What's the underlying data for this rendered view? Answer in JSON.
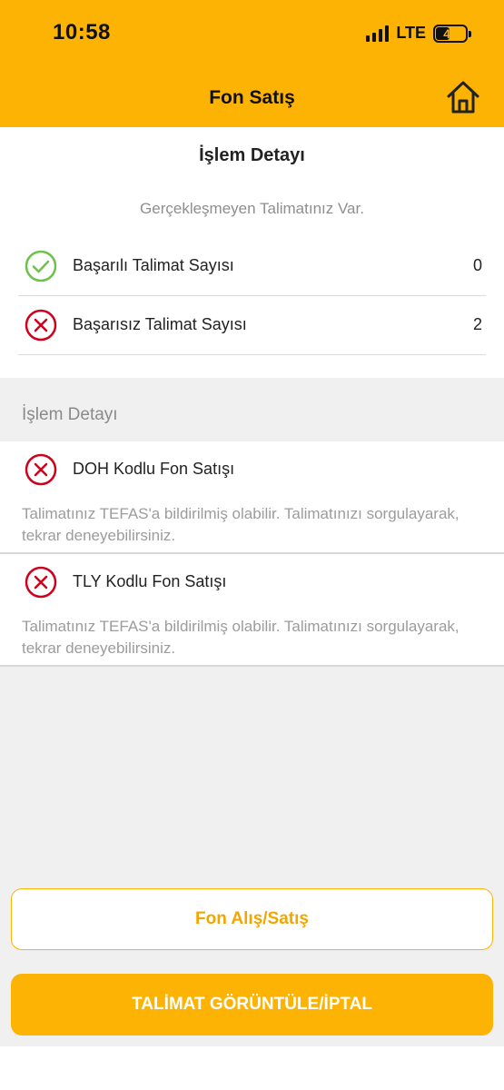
{
  "status_bar": {
    "time": "10:58",
    "network": "LTE",
    "battery": "47",
    "battery_level_pct": 47
  },
  "header": {
    "title": "Fon Satış",
    "home_icon": "home-icon"
  },
  "summary": {
    "title": "İşlem Detayı",
    "notice": "Gerçekleşmeyen Talimatınız Var.",
    "rows": [
      {
        "label": "Başarılı Talimat Sayısı",
        "value": "0",
        "icon": "check-circle-icon"
      },
      {
        "label": "Başarısız Talimat Sayısı",
        "value": "2",
        "icon": "error-circle-icon"
      }
    ]
  },
  "details": {
    "header": "İşlem Detayı",
    "items": [
      {
        "title": "DOH Kodlu Fon Satışı",
        "description": "Talimatınız TEFAS'a bildirilmiş olabilir. Talimatınızı sorgulayarak, tekrar deneyebilirsiniz.",
        "icon": "error-circle-icon"
      },
      {
        "title": "TLY Kodlu Fon Satışı",
        "description": "Talimatınız TEFAS'a bildirilmiş olabilir. Talimatınızı sorgulayarak, tekrar deneyebilirsiniz.",
        "icon": "error-circle-icon"
      }
    ]
  },
  "buttons": {
    "secondary": "Fon Alış/Satış",
    "primary": "TALİMAT GÖRÜNTÜLE/İPTAL"
  },
  "colors": {
    "accent": "#FDB303",
    "success": "#6CC24A",
    "error": "#D0021B"
  }
}
